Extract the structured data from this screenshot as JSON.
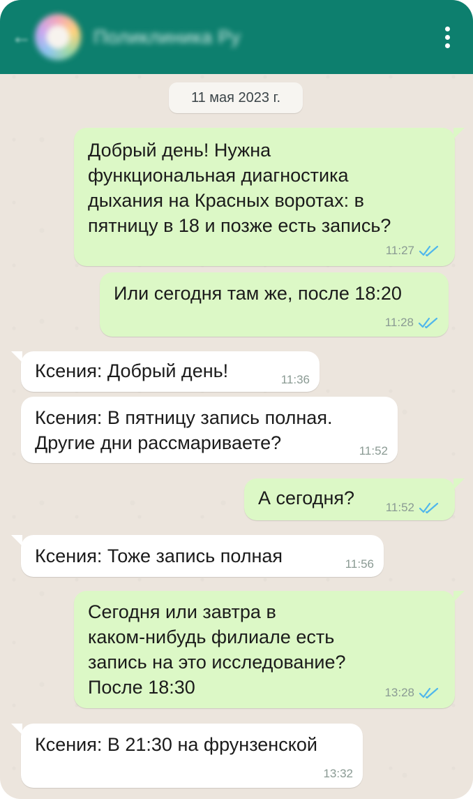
{
  "header": {
    "contact_name": "Поликлиника Ру",
    "back_glyph": "←"
  },
  "chat": {
    "date_chip": "11 мая 2023 г.",
    "messages": [
      {
        "direction": "outgoing",
        "text": "Добрый день! Нужна\nфункциональная диагностика\nдыхания на Красных воротах: в\nпятницу в 18 и позже есть запись?",
        "time": "11:27",
        "status": "read"
      },
      {
        "direction": "outgoing",
        "text": "Или сегодня там же, после 18:20",
        "time": "11:28",
        "status": "read"
      },
      {
        "direction": "incoming",
        "text": "Ксения: Добрый день!",
        "time": "11:36"
      },
      {
        "direction": "incoming",
        "text": "Ксения: В пятницу запись полная.\nДругие дни рассмариваете?",
        "time": "11:52"
      },
      {
        "direction": "outgoing",
        "text": "А сегодня?",
        "time": "11:52",
        "status": "read"
      },
      {
        "direction": "incoming",
        "text": "Ксения: Тоже запись полная",
        "time": "11:56"
      },
      {
        "direction": "outgoing",
        "text": "Сегодня или завтра в\nкаком-нибудь филиале есть\nзапись на это исследование?\nПосле 18:30",
        "time": "13:28",
        "status": "read"
      },
      {
        "direction": "incoming",
        "text": "Ксения: В 21:30 на фрунзенской",
        "time": "13:32"
      }
    ]
  },
  "colors": {
    "header": "#0d7f6e",
    "outgoing_bubble": "#dcf8c6",
    "incoming_bubble": "#ffffff",
    "read_ticks": "#4fb6ec",
    "wallpaper": "#ece5dd"
  },
  "icons": {
    "back": "arrow-left-icon",
    "menu": "more-vertical-icon",
    "read": "double-check-icon"
  }
}
